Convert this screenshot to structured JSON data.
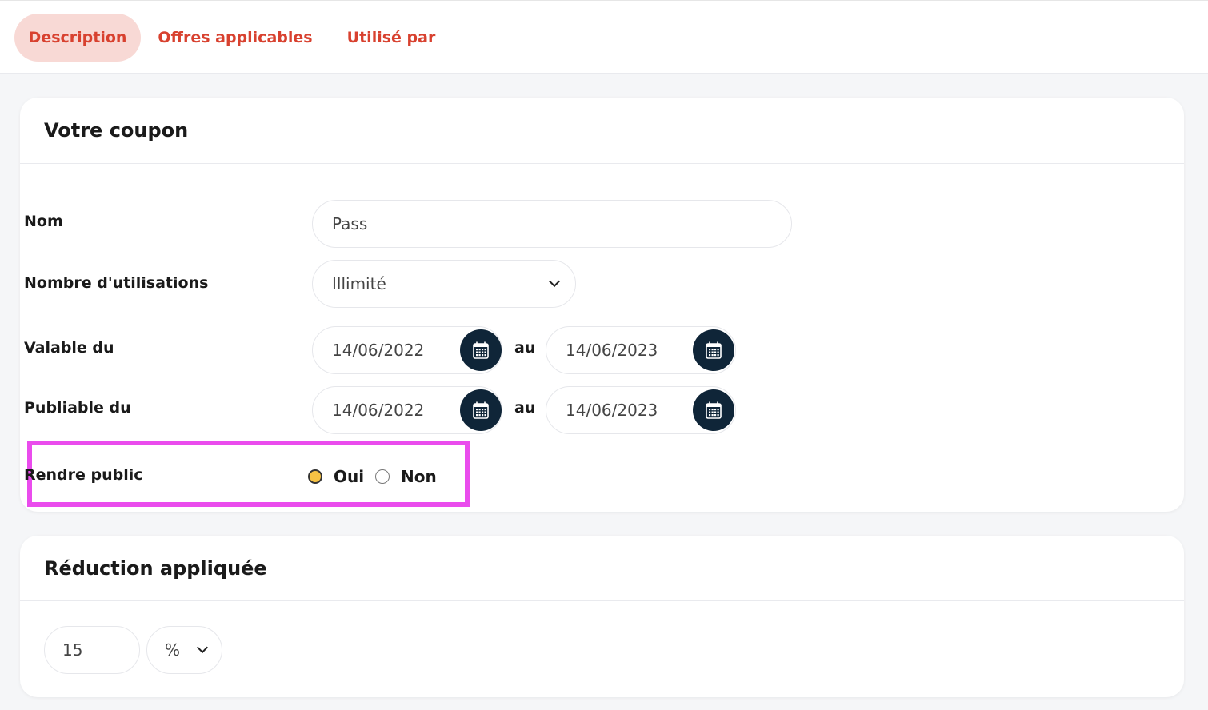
{
  "tabs": [
    {
      "label": "Description",
      "active": true
    },
    {
      "label": "Offres applicables",
      "active": false
    },
    {
      "label": "Utilisé par",
      "active": false
    }
  ],
  "coupon": {
    "title": "Votre coupon",
    "nom": {
      "label": "Nom",
      "value": "Pass"
    },
    "utilisations": {
      "label": "Nombre d'utilisations",
      "value": "Illimité"
    },
    "valable": {
      "label": "Valable du",
      "from": "14/06/2022",
      "separator": "au",
      "to": "14/06/2023"
    },
    "publiable": {
      "label": "Publiable du",
      "from": "14/06/2022",
      "separator": "au",
      "to": "14/06/2023"
    },
    "public": {
      "label": "Rendre public",
      "options": [
        "Oui",
        "Non"
      ],
      "selected": "Oui"
    }
  },
  "reduction": {
    "title": "Réduction appliquée",
    "value": "15",
    "unit": "%"
  },
  "colors": {
    "accent": "#d8412f",
    "tab_active_bg": "#f8d9d5",
    "calendar_button": "#0f2538",
    "radio_selected": "#f6c244",
    "highlight": "#ea4ced"
  },
  "icons": {
    "calendar": "calendar-icon",
    "dropdown": "chevron-down-icon"
  }
}
